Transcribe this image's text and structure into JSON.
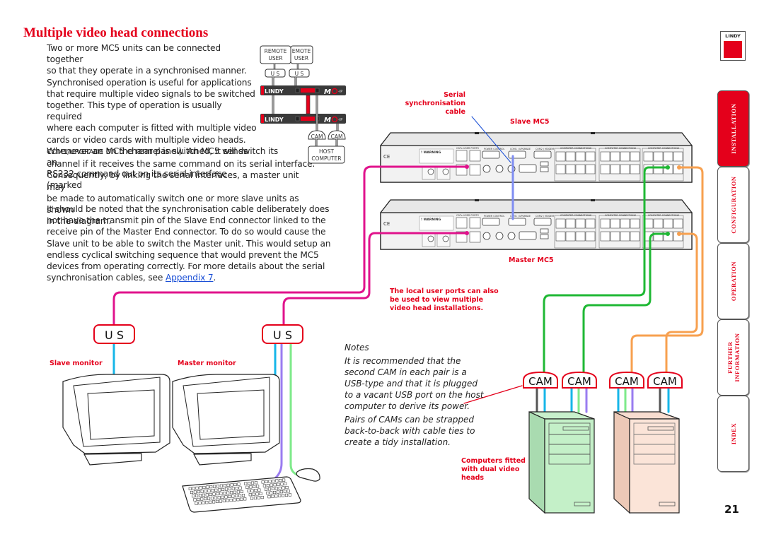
{
  "page": {
    "title": "Multiple video head connections",
    "page_number": "21"
  },
  "body": {
    "para1_lines": [
      "Two or more MC5 units can be connected together",
      "so that they operate in a synchronised manner.",
      "Synchronised operation is useful for applications",
      "that require multiple video signals to be switched",
      "together. This type of operation is usually required",
      "where each computer is fitted with multiple video",
      "cards or video cards with multiple video heads.",
      "Whenever an MC5 channel is switched, it sends an",
      "RS232 command out on its serial interface (marked"
    ],
    "para1_marked": "COM1/UPGRADE",
    "para1_after_marked": " on the rear panel). An MC5 will switch its",
    "para1_tail_lines": [
      "channel if it receives the same command on its serial interface.",
      "Consequently, by linking the serial interfaces, a master unit may",
      "be made to automatically switch one or more slave units as shown",
      "in the diagram."
    ],
    "para2_text": "It should be noted that the synchronisation cable deliberately does not have the transmit pin of the Slave End connector linked to the receive pin of the Master End connector. To do so would cause the Slave unit to be able to switch the Master unit. This would setup an endless cyclical switching sequence that would prevent the MC5 devices from operating correctly. For more details about the serial synchronisation cables, see ",
    "para2_link": "Appendix 7",
    "para2_end": "."
  },
  "mini_diagram": {
    "remote_user_1": [
      "REMOTE",
      "USER"
    ],
    "remote_user_2": [
      "EMOTE",
      "USER"
    ],
    "us_label": "U S",
    "cam_label": "CAM",
    "host_computer": [
      "HOST",
      "COMPUTER"
    ],
    "brand": "LINDY",
    "product": "MC5-IP"
  },
  "diagram": {
    "serial_cable_label": [
      "Serial",
      "synchronisation",
      "cable"
    ],
    "slave_mc5_label": "Slave MC5",
    "master_mc5_label": "Master MC5",
    "local_user_note": [
      "The local user ports can also",
      "be used to view multiple",
      "video head installations."
    ],
    "us_module_label": "U S",
    "cam_module_label": "CAM",
    "slave_monitor_label": "Slave monitor",
    "master_monitor_label": "Master monitor",
    "computers_label": [
      "Computers fitted",
      "with dual video",
      "heads"
    ],
    "panel": {
      "warning": "! WARNING",
      "cat_user_ports": "CATx USER PORTS",
      "power_control": "POWER CONTROL",
      "com1_upgrade": "COM1 / UPGRADE",
      "com2_modem": "COM2 / MODEM",
      "computer_connections": "COMPUTER CONNECTIONS",
      "ce": "CE"
    },
    "cable_colors": {
      "pink": "#e0138c",
      "blue_serial": "#7f8df2",
      "green": "#1fb834",
      "orange": "#f7a04f",
      "cyan": "#16b6e8",
      "purple": "#9a7cf0",
      "light_green": "#7eea8a",
      "grey": "#555555"
    }
  },
  "notes": {
    "heading": "Notes",
    "note1_lines": [
      "It is recommended that the",
      "second CAM in each pair is a",
      "USB-type and that it is plugged",
      "to a vacant USB port on the host",
      "computer to derive its power."
    ],
    "note2_lines": [
      "Pairs of CAMs can be strapped",
      "back-to-back with cable ties to",
      "create a tidy installation."
    ]
  },
  "sidebar": {
    "logo_text": "LINDY",
    "tabs": [
      {
        "label": "INSTALLATION",
        "active": true
      },
      {
        "label": "CONFIGURATION",
        "active": false
      },
      {
        "label": "OPERATION",
        "active": false
      },
      {
        "label": "FURTHER\nINFORMATION",
        "active": false
      },
      {
        "label": "INDEX",
        "active": false
      }
    ]
  },
  "colors": {
    "accent_red": "#e4001b",
    "link_blue": "#1a4fd6"
  }
}
